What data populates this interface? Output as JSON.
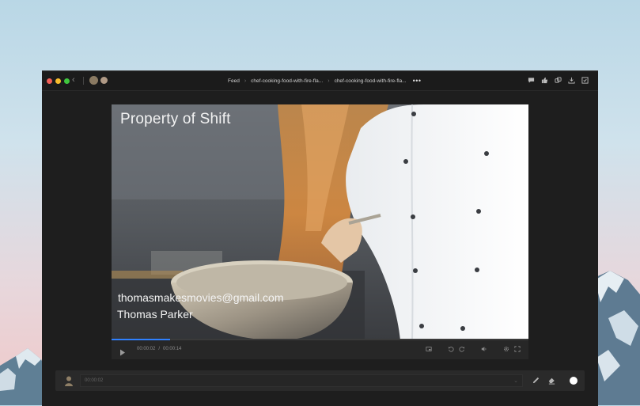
{
  "titlebar": {
    "breadcrumbs": [
      "Feed",
      "chef-cooking-food-with-fire-fla...",
      "chef-cooking-food-with-fire-fla..."
    ],
    "more_label": "•••",
    "icons": [
      "comment-icon",
      "thumbs-up-icon",
      "versions-icon",
      "download-icon",
      "approve-icon"
    ]
  },
  "video": {
    "watermark_title": "Property of Shift",
    "watermark_email": "thomasmakesmovies@gmail.com",
    "watermark_name": "Thomas Parker",
    "progress_fraction": 0.14
  },
  "player": {
    "current_time": "00:00:02",
    "separator": "/",
    "total_time": "00:00:14"
  },
  "comment": {
    "timestamp": "00:00:02",
    "dropdown_icon": "chevron-down-icon",
    "tools": [
      "pencil-icon",
      "eraser-icon"
    ],
    "color": "#ffffff"
  },
  "colors": {
    "accent": "#2f80ff",
    "window_bg": "#1e1e1e",
    "titlebar_bg": "#1b1b1b"
  }
}
